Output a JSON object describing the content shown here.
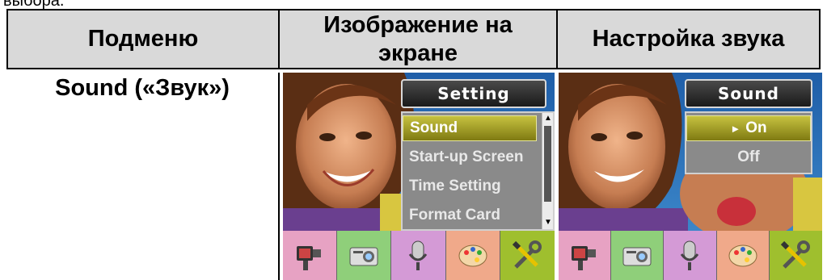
{
  "cut_off_text": "выбора.",
  "table": {
    "headers": {
      "submenu": "Подменю",
      "screen": "Изображение на экране",
      "setting": "Настройка звука"
    },
    "row": {
      "submenu_name": "Sound («Звук»)"
    }
  },
  "screen_menu": {
    "title": "Setting",
    "items": [
      "Sound",
      "Start-up Screen",
      "Time Setting",
      "Format Card"
    ],
    "selected_index": 0
  },
  "screen_sound": {
    "title": "Sound",
    "options": [
      {
        "label": "On",
        "selected": true,
        "marker": "►"
      },
      {
        "label": "Off",
        "selected": false
      }
    ]
  },
  "mode_bar": {
    "icons": [
      "video-camera-icon",
      "camera-icon",
      "microphone-icon",
      "palette-icon",
      "wrench-screwdriver-icon"
    ],
    "colors": [
      "#e7a2c3",
      "#8fcf7a",
      "#d49ad6",
      "#f0a98a",
      "#9fbf2e"
    ],
    "active_index": 4
  }
}
